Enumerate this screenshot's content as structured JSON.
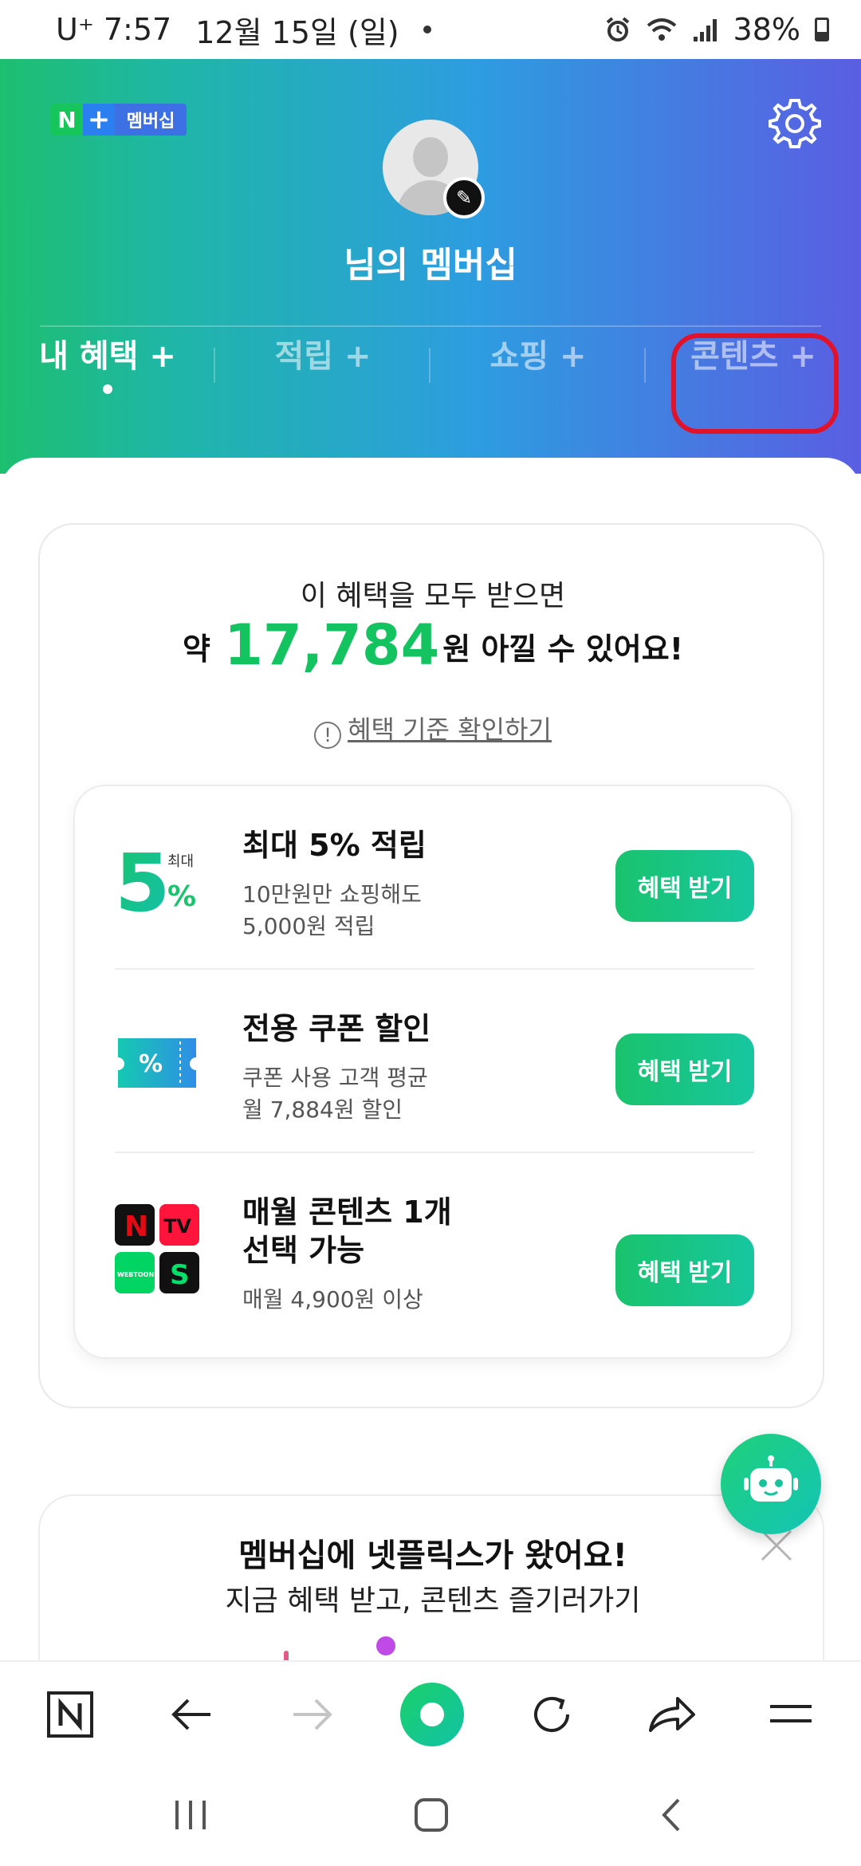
{
  "status_bar": {
    "carrier": "U⁺",
    "time": "7:57",
    "date": "12월 15일 (일)",
    "battery": "38%"
  },
  "header": {
    "logo_n": "N",
    "logo_plus": "+",
    "logo_text": "멤버십",
    "title": "님의 멤버십",
    "tabs": [
      {
        "label": "내 혜택 +"
      },
      {
        "label": "적립 +"
      },
      {
        "label": "쇼핑 +"
      },
      {
        "label": "콘텐츠 +"
      }
    ],
    "highlight_color": "#e2122a"
  },
  "summary": {
    "line1": "이 혜택을 모두 받으면",
    "prefix": "약",
    "amount": "17,784",
    "suffix": "원 아낄 수 있어요!",
    "link_icon": "!",
    "link_text": "혜택 기준 확인하기"
  },
  "benefits": [
    {
      "title": "최대 5% 적립",
      "desc1": "10만원만 쇼핑해도",
      "desc2": "5,000원 적립",
      "button": "혜택 받기",
      "icon": "five-percent-icon",
      "icon_label_small": "최대",
      "icon_label_big": "5",
      "icon_label_pct": "%"
    },
    {
      "title": "전용 쿠폰 할인",
      "desc1": "쿠폰 사용 고객 평균",
      "desc2": "월 7,884원 할인",
      "button": "혜택 받기",
      "icon": "coupon-icon",
      "icon_label": "%"
    },
    {
      "title": "매월 콘텐츠 1개",
      "title2": "선택 가능",
      "desc1": "매월 4,900원 이상",
      "button": "혜택 받기",
      "icon": "content-apps-icon",
      "apps": [
        "N",
        "TV",
        "WEBTOON",
        "S"
      ]
    }
  ],
  "promo": {
    "title": "멤버십에 넷플릭스가 왔어요!",
    "subtitle": "지금 혜택 받고, 콘텐츠 즐기러가기"
  },
  "colors": {
    "accent_green": "#12c35f",
    "gradient_start": "#1dbf6f",
    "gradient_end": "#5a5ee2"
  }
}
